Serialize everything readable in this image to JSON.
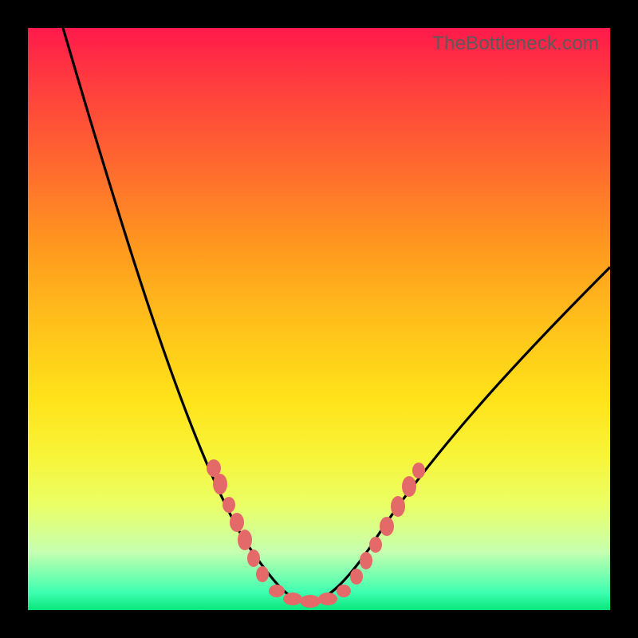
{
  "attribution": "TheBottleneck.com",
  "chart_data": {
    "type": "line",
    "title": "",
    "xlabel": "",
    "ylabel": "",
    "xlim": [
      0,
      100
    ],
    "ylim": [
      0,
      100
    ],
    "series": [
      {
        "name": "bottleneck-curve",
        "x": [
          6,
          10,
          14,
          18,
          22,
          26,
          30,
          33,
          36,
          39,
          41,
          43,
          45,
          48,
          51,
          55,
          58,
          62,
          66,
          70,
          75,
          80,
          86,
          92,
          100
        ],
        "y": [
          100,
          86,
          73,
          61,
          50,
          40,
          31,
          24,
          18,
          12,
          8,
          5,
          3,
          2,
          2,
          4,
          8,
          13,
          19,
          25,
          32,
          39,
          46,
          52,
          59
        ]
      }
    ],
    "markers": [
      {
        "x_range": [
          31,
          34
        ],
        "y_range": [
          20,
          27
        ]
      },
      {
        "x_range": [
          35,
          37
        ],
        "y_range": [
          14,
          19
        ]
      },
      {
        "x_range": [
          38,
          41
        ],
        "y_range": [
          7,
          13
        ]
      },
      {
        "x_range": [
          44,
          52
        ],
        "y_range": [
          2,
          4
        ]
      },
      {
        "x_range": [
          55,
          58
        ],
        "y_range": [
          5,
          9
        ]
      },
      {
        "x_range": [
          59,
          61
        ],
        "y_range": [
          10,
          14
        ]
      },
      {
        "x_range": [
          62,
          67
        ],
        "y_range": [
          15,
          22
        ]
      }
    ],
    "colors": {
      "curve": "#000000",
      "markers": "#e46a6a",
      "gradient_top": "#ff1a4b",
      "gradient_bottom": "#08e67a"
    }
  }
}
